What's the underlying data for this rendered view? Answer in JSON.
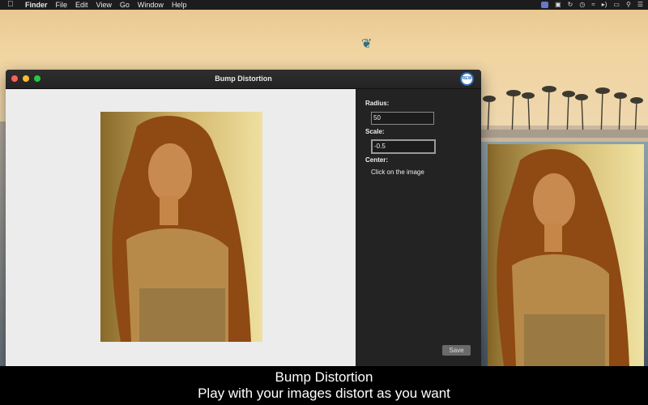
{
  "menubar": {
    "apple": "",
    "items": [
      "Finder",
      "File",
      "Edit",
      "View",
      "Go",
      "Window",
      "Help"
    ]
  },
  "window": {
    "title": "Bump Distortion",
    "badge": "REW"
  },
  "panel": {
    "radius_label": "Radius:",
    "radius_value": "50",
    "scale_label": "Scale:",
    "scale_value": "-0.5",
    "center_label": "Center:",
    "center_hint": "Click on the image",
    "save_label": "Save"
  },
  "caption": {
    "line1": "Bump Distortion",
    "line2": "Play with your images distort as you want"
  },
  "colors": {
    "accent_badge": "#2d6bb5",
    "panel_bg": "#232323",
    "canvas_bg": "#ececec"
  }
}
